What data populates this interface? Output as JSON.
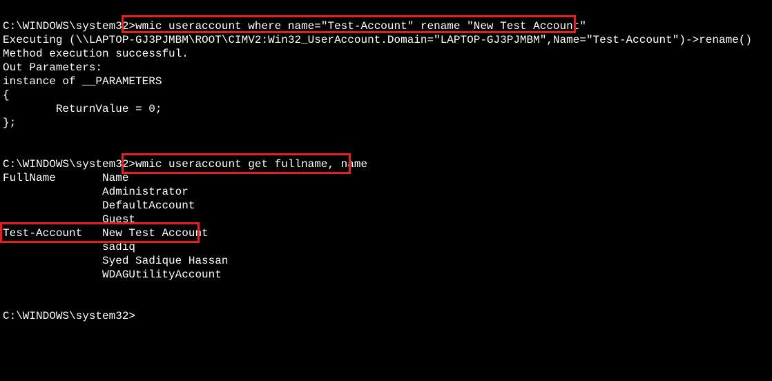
{
  "prompt1": {
    "path": "C:\\WINDOWS\\system32>",
    "command": "wmic useraccount where name=\"Test-Account\" rename \"New Test Account\""
  },
  "output1": {
    "line1": "Executing (\\\\LAPTOP-GJ3PJMBM\\ROOT\\CIMV2:Win32_UserAccount.Domain=\"LAPTOP-GJ3PJMBM\",Name=\"Test-Account\")->rename()",
    "line2": "Method execution successful.",
    "line3": "Out Parameters:",
    "line4": "instance of __PARAMETERS",
    "line5": "{",
    "line6": "        ReturnValue = 0;",
    "line7": "};"
  },
  "prompt2": {
    "path": "C:\\WINDOWS\\system32>",
    "command": "wmic useraccount get fullname, name"
  },
  "table": {
    "header": "FullName       Name",
    "rows": [
      {
        "text": "               Administrator"
      },
      {
        "text": "               DefaultAccount"
      },
      {
        "text": "               Guest"
      },
      {
        "text": "Test-Account   New Test Account"
      },
      {
        "text": "               sadiq"
      },
      {
        "text": "               Syed Sadique Hassan"
      },
      {
        "text": "               WDAGUtilityAccount"
      }
    ]
  },
  "prompt3": {
    "path": "C:\\WINDOWS\\system32>",
    "command": ""
  }
}
